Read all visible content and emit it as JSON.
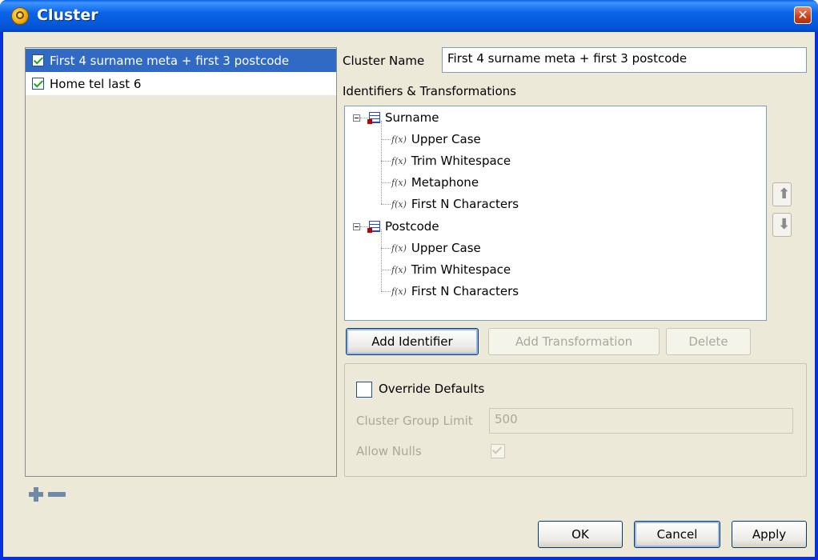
{
  "window": {
    "title": "Cluster"
  },
  "clusters": [
    {
      "label": "First 4 surname meta + first 3 postcode",
      "checked": true,
      "selected": true
    },
    {
      "label": "Home tel last 6",
      "checked": true,
      "selected": false
    }
  ],
  "cluster_name": {
    "label": "Cluster Name",
    "value": "First 4 surname meta + first 3 postcode"
  },
  "identifiers": {
    "label": "Identifiers & Transformations",
    "tree": [
      {
        "name": "Surname",
        "transforms": [
          "Upper Case",
          "Trim Whitespace",
          "Metaphone",
          "First N Characters"
        ]
      },
      {
        "name": "Postcode",
        "transforms": [
          "Upper Case",
          "Trim Whitespace",
          "First N Characters"
        ]
      }
    ]
  },
  "buttons": {
    "add_identifier": "Add Identifier",
    "add_transformation": "Add Transformation",
    "delete": "Delete",
    "ok": "OK",
    "cancel": "Cancel",
    "apply": "Apply"
  },
  "defaults": {
    "override_label": "Override Defaults",
    "override_checked": false,
    "group_limit_label": "Cluster Group Limit",
    "group_limit_value": "500",
    "allow_nulls_label": "Allow Nulls",
    "allow_nulls_checked": true
  }
}
